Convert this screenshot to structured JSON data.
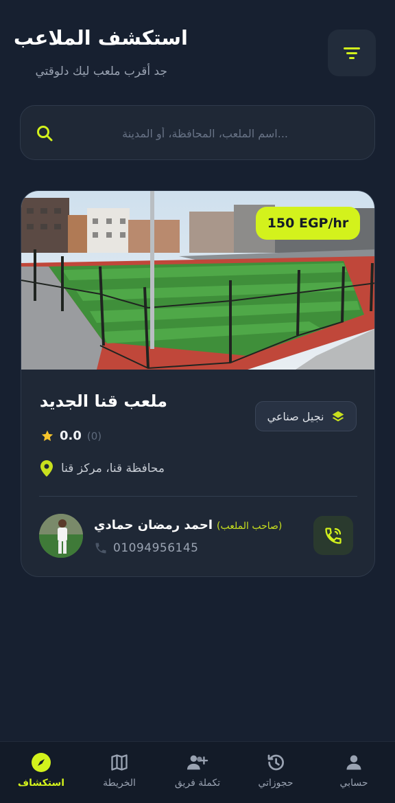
{
  "header": {
    "title": "استكشف الملاعب",
    "subtitle": "جد أقرب ملعب ليك دلوقتي"
  },
  "search": {
    "placeholder": "...اسم الملعب، المحافظة، أو المدينة",
    "value": ""
  },
  "field_card": {
    "price": "150 EGP/hr",
    "name": "ملعب قنا الجديد",
    "rating": "0.0",
    "rating_count": "(0)",
    "surface": "نجيل صناعي",
    "location": "محافظة قنا، مركز قنا",
    "owner": {
      "name": "احمد رمضان حمادي",
      "role": "(صاحب الملعب)",
      "phone": "01094956145"
    }
  },
  "nav": {
    "items": [
      {
        "label": "استكشاف",
        "icon": "compass-icon",
        "active": true
      },
      {
        "label": "الخريطة",
        "icon": "map-icon",
        "active": false
      },
      {
        "label": "تكملة فريق",
        "icon": "add-people-icon",
        "active": false
      },
      {
        "label": "حجوزاتي",
        "icon": "history-icon",
        "active": false
      },
      {
        "label": "حسابي",
        "icon": "person-icon",
        "active": false
      }
    ]
  },
  "colors": {
    "background": "#172030",
    "card": "#1f2836",
    "accent": "#d3f21c",
    "muted_text": "#9aa3b2"
  }
}
